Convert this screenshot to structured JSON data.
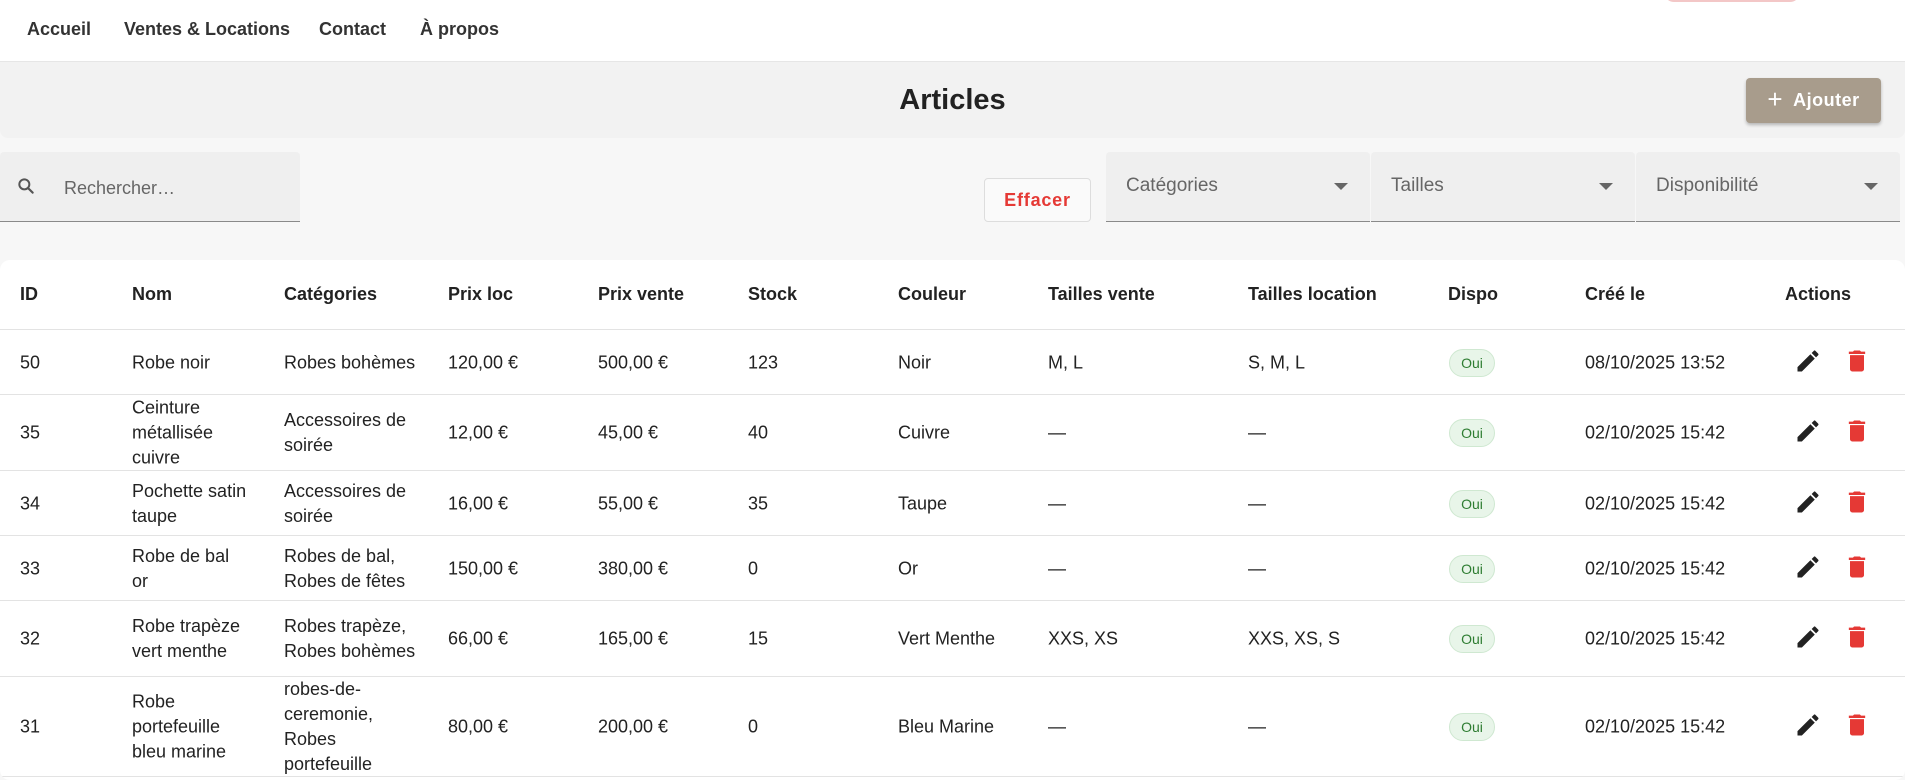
{
  "nav": [
    "Accueil",
    "Ventes & Locations",
    "Contact",
    "À propos"
  ],
  "header": {
    "title": "Articles",
    "add_label": "Ajouter",
    "add_icon": "plus-icon"
  },
  "filters": {
    "search_placeholder": "Rechercher…",
    "search_value": "",
    "clear_label": "Effacer",
    "categories_label": "Catégories",
    "sizes_label": "Tailles",
    "availability_label": "Disponibilité"
  },
  "table": {
    "columns": [
      "ID",
      "Nom",
      "Catégories",
      "Prix loc",
      "Prix vente",
      "Stock",
      "Couleur",
      "Tailles vente",
      "Tailles location",
      "Dispo",
      "Créé le",
      "Actions"
    ],
    "rows": [
      {
        "id": "50",
        "nom": "Robe noir",
        "categories": "Robes bohèmes",
        "prix_loc": "120,00 €",
        "prix_vente": "500,00 €",
        "stock": "123",
        "couleur": "Noir",
        "tailles_vente": "M, L",
        "tailles_location": "S, M, L",
        "dispo": "Oui",
        "cree_le": "08/10/2025 13:52"
      },
      {
        "id": "35",
        "nom": "Ceinture métallisée cuivre",
        "categories": "Accessoires de soirée",
        "prix_loc": "12,00 €",
        "prix_vente": "45,00 €",
        "stock": "40",
        "couleur": "Cuivre",
        "tailles_vente": "—",
        "tailles_location": "—",
        "dispo": "Oui",
        "cree_le": "02/10/2025 15:42"
      },
      {
        "id": "34",
        "nom": "Pochette satin taupe",
        "categories": "Accessoires de soirée",
        "prix_loc": "16,00 €",
        "prix_vente": "55,00 €",
        "stock": "35",
        "couleur": "Taupe",
        "tailles_vente": "—",
        "tailles_location": "—",
        "dispo": "Oui",
        "cree_le": "02/10/2025 15:42"
      },
      {
        "id": "33",
        "nom": "Robe de bal or",
        "categories": "Robes de bal, Robes de fêtes",
        "prix_loc": "150,00 €",
        "prix_vente": "380,00 €",
        "stock": "0",
        "couleur": "Or",
        "tailles_vente": "—",
        "tailles_location": "—",
        "dispo": "Oui",
        "cree_le": "02/10/2025 15:42"
      },
      {
        "id": "32",
        "nom": "Robe trapèze vert menthe",
        "categories": "Robes trapèze, Robes bohèmes",
        "prix_loc": "66,00 €",
        "prix_vente": "165,00 €",
        "stock": "15",
        "couleur": "Vert Menthe",
        "tailles_vente": "XXS, XS",
        "tailles_location": "XXS, XS, S",
        "dispo": "Oui",
        "cree_le": "02/10/2025 15:42"
      },
      {
        "id": "31",
        "nom": "Robe portefeuille bleu marine",
        "categories": "robes-de-ceremonie, Robes portefeuille",
        "prix_loc": "80,00 €",
        "prix_vente": "200,00 €",
        "stock": "0",
        "couleur": "Bleu Marine",
        "tailles_vente": "—",
        "tailles_location": "—",
        "dispo": "Oui",
        "cree_le": "02/10/2025 15:42"
      }
    ]
  },
  "icons": {
    "search": "search-icon",
    "edit": "pencil-icon",
    "delete": "trash-icon",
    "dropdown": "caret-down-icon"
  },
  "colors": {
    "accent": "#a89c8c",
    "danger": "#e53935",
    "success_bg": "#e8f5e9",
    "success_text": "#2e7d32"
  }
}
